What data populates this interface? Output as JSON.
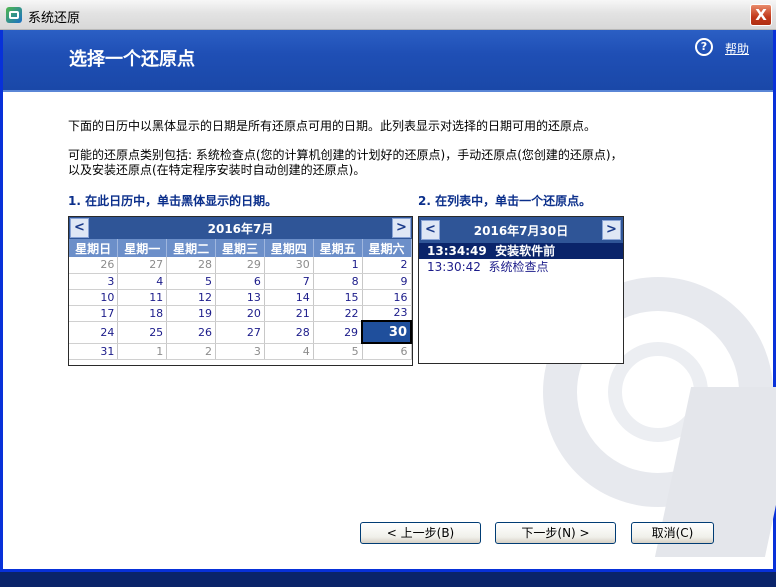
{
  "window": {
    "title": "系统还原",
    "close_glyph": "X"
  },
  "header": {
    "page_title": "选择一个还原点",
    "help_label": "帮助"
  },
  "intro": {
    "line1": "下面的日历中以黑体显示的日期是所有还原点可用的日期。此列表显示对选择的日期可用的还原点。",
    "line2a": "可能的还原点类别包括: 系统检查点(您的计算机创建的计划好的还原点)，手动还原点(您创建的还原点)，",
    "line2b": "以及安装还原点(在特定程序安装时自动创建的还原点)。"
  },
  "step1": "1. 在此日历中，单击黑体显示的日期。",
  "step2": "2. 在列表中，单击一个还原点。",
  "calendar": {
    "title": "2016年7月",
    "prev": "<",
    "next": ">",
    "weekdays": [
      "星期日",
      "星期一",
      "星期二",
      "星期三",
      "星期四",
      "星期五",
      "星期六"
    ],
    "weeks": [
      [
        "26",
        "27",
        "28",
        "29",
        "30",
        "1",
        "2"
      ],
      [
        "3",
        "4",
        "5",
        "6",
        "7",
        "8",
        "9"
      ],
      [
        "10",
        "11",
        "12",
        "13",
        "14",
        "15",
        "16"
      ],
      [
        "17",
        "18",
        "19",
        "20",
        "21",
        "22",
        "23"
      ],
      [
        "24",
        "25",
        "26",
        "27",
        "28",
        "29",
        "30"
      ],
      [
        "31",
        "1",
        "2",
        "3",
        "4",
        "5",
        "6"
      ]
    ],
    "selected": "30"
  },
  "restore_list": {
    "date_title": "2016年7月30日",
    "prev": "<",
    "next": ">",
    "items": [
      {
        "time": "13:34:49",
        "desc": "安装软件前"
      },
      {
        "time": "13:30:42",
        "desc": "系统检查点"
      }
    ]
  },
  "buttons": {
    "back": "< 上一步(B)",
    "next": "下一步(N) >",
    "cancel": "取消(C)"
  },
  "colors": {
    "header_blue": "#1f4fb5",
    "calendar_header": "#2f5597",
    "selection": "#0a246a"
  }
}
